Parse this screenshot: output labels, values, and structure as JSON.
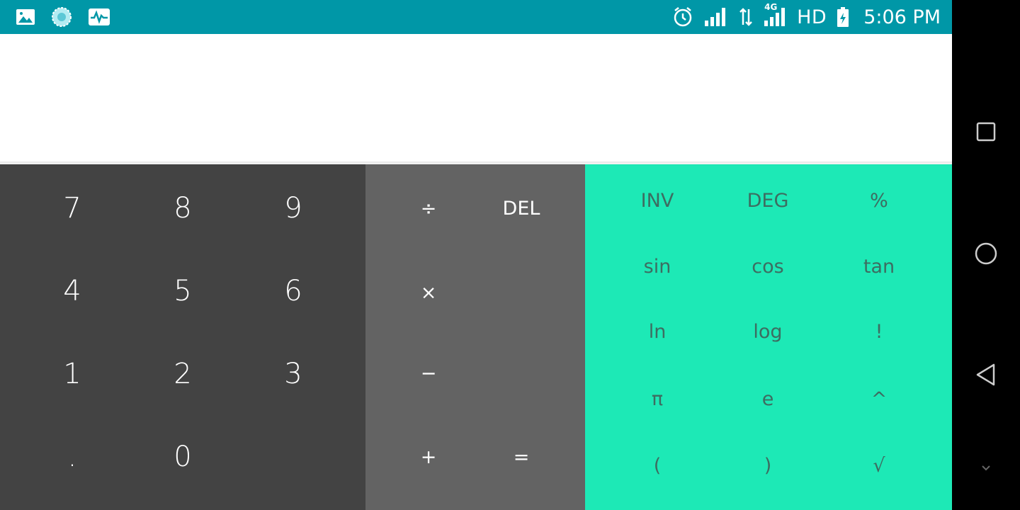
{
  "status_bar": {
    "left_icons": [
      "image-icon",
      "browser-icon",
      "activity-icon"
    ],
    "alarm_icon": "alarm-icon",
    "signal_icon": "signal-icon",
    "network_type": "4G",
    "hd_label": "HD",
    "battery_icon": "battery-charging-icon",
    "time": "5:06 PM",
    "background_color": "#0097a7"
  },
  "display": {
    "formula": "",
    "result": ""
  },
  "numeric_pad": {
    "background_color": "#434343",
    "keys": [
      "7",
      "8",
      "9",
      "4",
      "5",
      "6",
      "1",
      "2",
      "3",
      ".",
      "0"
    ]
  },
  "operator_pad": {
    "background_color": "#636363",
    "divide": "÷",
    "delete": "DEL",
    "multiply": "×",
    "minus": "−",
    "plus": "+",
    "equals": "="
  },
  "advanced_pad": {
    "background_color": "#1de9b6",
    "text_color": "#3d6d61",
    "keys": [
      "INV",
      "DEG",
      "%",
      "sin",
      "cos",
      "tan",
      "ln",
      "log",
      "!",
      "π",
      "e",
      "^",
      "(",
      ")",
      "√"
    ]
  },
  "nav_bar": {
    "recents": "square-icon",
    "home": "circle-icon",
    "back": "triangle-back-icon"
  }
}
